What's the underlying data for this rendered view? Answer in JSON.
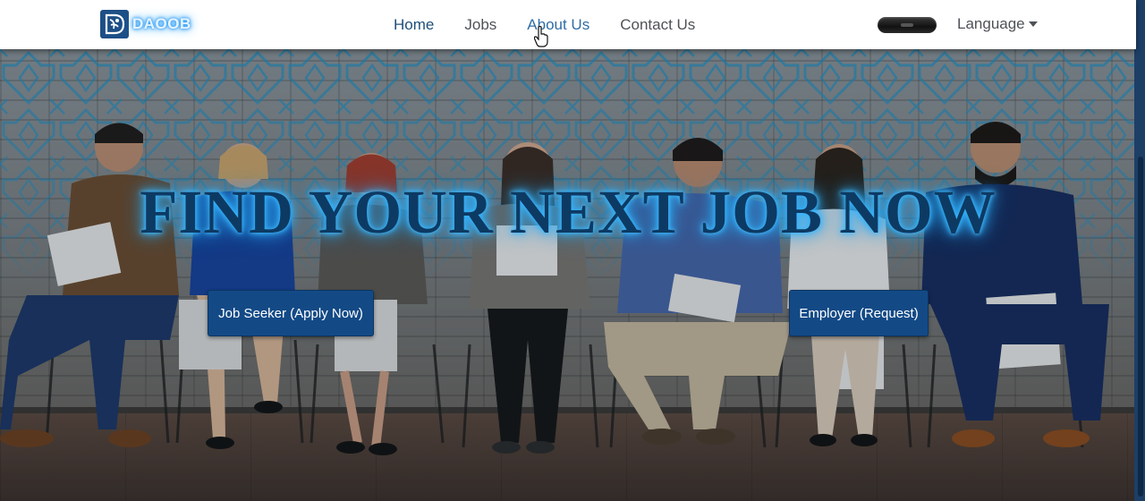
{
  "brand": {
    "name": "DAOOB",
    "logo_icon": "daoob-logo-icon"
  },
  "nav": {
    "links": [
      {
        "label": "Home",
        "state": "active"
      },
      {
        "label": "Jobs",
        "state": "default"
      },
      {
        "label": "About Us",
        "state": "hovered"
      },
      {
        "label": "Contact Us",
        "state": "default"
      }
    ],
    "language_label": "Language"
  },
  "hero": {
    "headline": "FIND YOUR NEXT JOB NOW",
    "seeker_button": "Job Seeker (Apply Now)",
    "employer_button": "Employer (Request)"
  },
  "colors": {
    "primary": "#134a86",
    "headline_text": "#0d3a63",
    "glow": "#33b5ff",
    "nav_text": "#4e5257"
  }
}
